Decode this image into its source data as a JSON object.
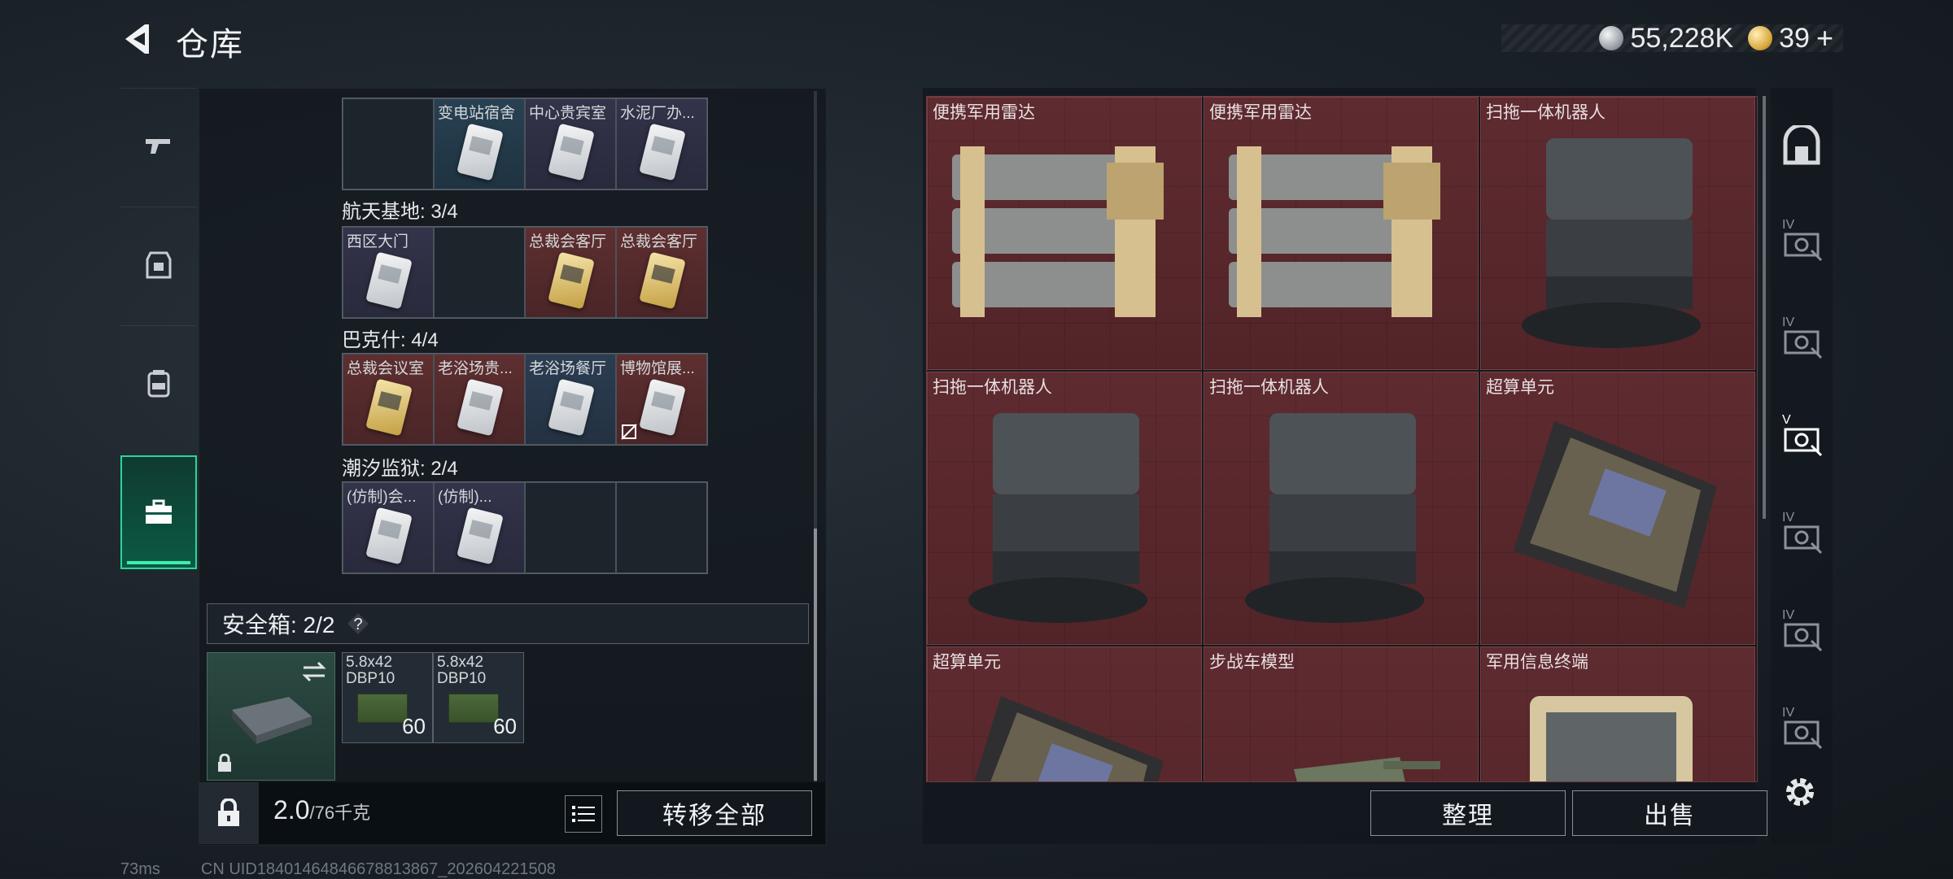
{
  "header": {
    "title": "仓库",
    "currency_silver": "55,228K",
    "currency_gold": "39",
    "plus": "+"
  },
  "left_rail": {
    "tabs": [
      "weapon",
      "armor",
      "backpack",
      "keycase"
    ]
  },
  "key_case": {
    "sections": [
      {
        "heading": "",
        "slots": [
          {
            "label": "",
            "color": "empty",
            "card": ""
          },
          {
            "label": "变电站宿舍",
            "color": "teal",
            "card": "white"
          },
          {
            "label": "中心贵宾室",
            "color": "purple",
            "card": "white"
          },
          {
            "label": "水泥厂办...",
            "color": "purple",
            "card": "white"
          }
        ]
      },
      {
        "heading": "航天基地: 3/4",
        "slots": [
          {
            "label": "西区大门",
            "color": "purple",
            "card": "white"
          },
          {
            "label": "",
            "color": "empty",
            "card": ""
          },
          {
            "label": "总裁会客厅",
            "color": "red",
            "card": "gold"
          },
          {
            "label": "总裁会客厅",
            "color": "red",
            "card": "gold"
          }
        ]
      },
      {
        "heading": "巴克什: 4/4",
        "slots": [
          {
            "label": "总裁会议室",
            "color": "red",
            "card": "gold"
          },
          {
            "label": "老浴场贵...",
            "color": "red",
            "card": "white"
          },
          {
            "label": "老浴场餐厅",
            "color": "blue",
            "card": "white"
          },
          {
            "label": "博物馆展...",
            "color": "red",
            "card": "white"
          }
        ]
      },
      {
        "heading": "潮汐监狱: 2/4",
        "slots": [
          {
            "label": "(仿制)会...",
            "color": "purple",
            "card": "white"
          },
          {
            "label": "(仿制)...",
            "color": "purple",
            "card": "white"
          },
          {
            "label": "",
            "color": "empty",
            "card": ""
          },
          {
            "label": "",
            "color": "empty",
            "card": ""
          }
        ]
      }
    ]
  },
  "safebox": {
    "label": "安全箱:  2/2",
    "ammo": [
      {
        "label": "5.8x42 DBP10",
        "count": "60"
      },
      {
        "label": "5.8x42 DBP10",
        "count": "60"
      }
    ]
  },
  "footer_left": {
    "weight": "2.0",
    "weight_max": "/76千克",
    "transfer_all": "转移全部"
  },
  "stash": {
    "items": [
      {
        "label": "便携军用雷达",
        "kind": "radar"
      },
      {
        "label": "便携军用雷达",
        "kind": "radar"
      },
      {
        "label": "扫拖一体机器人",
        "kind": "robot"
      },
      {
        "label": "扫拖一体机器人",
        "kind": "robot"
      },
      {
        "label": "扫拖一体机器人",
        "kind": "robot"
      },
      {
        "label": "超算单元",
        "kind": "board"
      },
      {
        "label": "超算单元",
        "kind": "board"
      },
      {
        "label": "步战车模型",
        "kind": "tank"
      },
      {
        "label": "军用信息终端",
        "kind": "terminal"
      }
    ]
  },
  "footer_right": {
    "sort": "整理",
    "sell": "出售"
  },
  "right_rail": {
    "tiers": [
      "IV",
      "IV",
      "V",
      "IV",
      "IV",
      "IV"
    ]
  },
  "status_bar": {
    "ping": "73ms",
    "uid": "CN UID18401464846678813867_202604221508"
  },
  "colors": {
    "accent": "#2bd69a",
    "stash_bg": "#5e2b30"
  }
}
